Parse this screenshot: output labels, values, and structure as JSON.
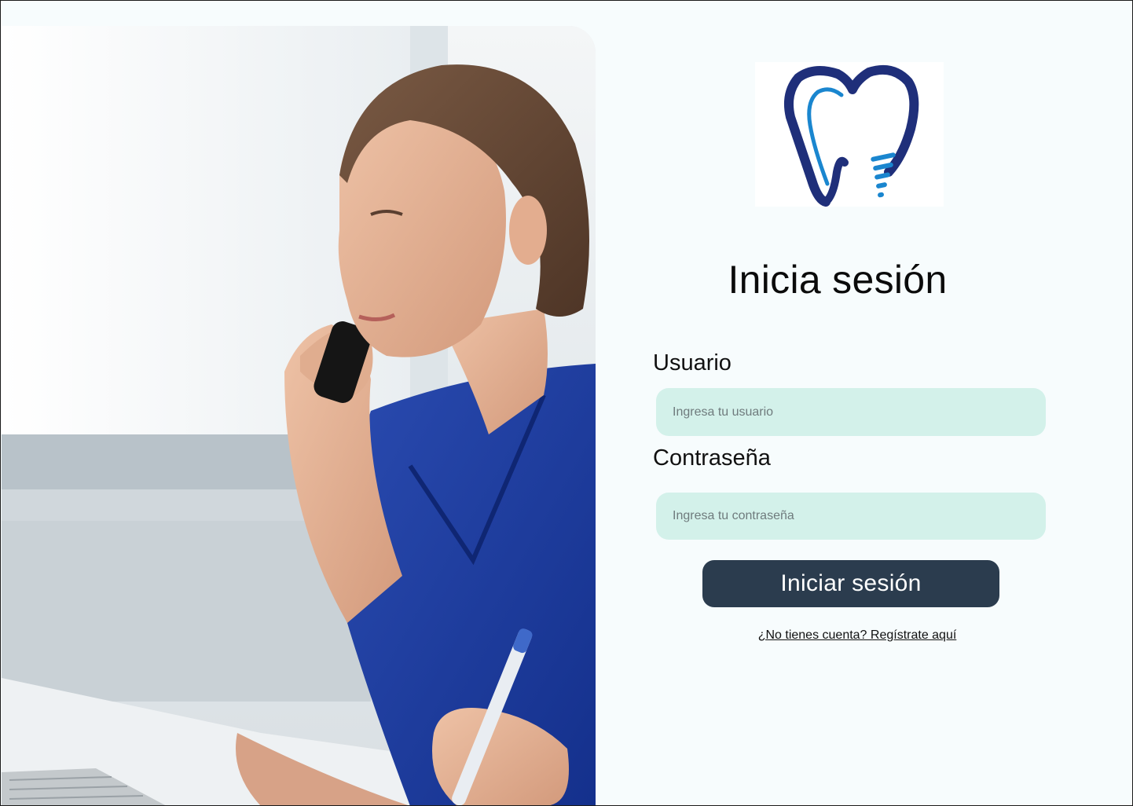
{
  "hero": {
    "image": "nurse-on-phone-photo"
  },
  "logo": {
    "icon": "dental-implant-tooth-logo",
    "colors": {
      "outer": "#1f2f7a",
      "inner": "#1a86cf"
    }
  },
  "login": {
    "title": "Inicia sesión",
    "user_label": "Usuario",
    "user_placeholder": "Ingresa tu usuario",
    "password_label": "Contraseña",
    "password_placeholder": "Ingresa tu contraseña",
    "submit_label": "Iniciar sesión",
    "register_link": "¿No tienes cuenta? Regístrate aquí"
  },
  "colors": {
    "page_bg": "#f7fcfd",
    "input_bg": "#d3f1ea",
    "button_bg": "#2b3c4e",
    "button_text": "#ffffff"
  }
}
